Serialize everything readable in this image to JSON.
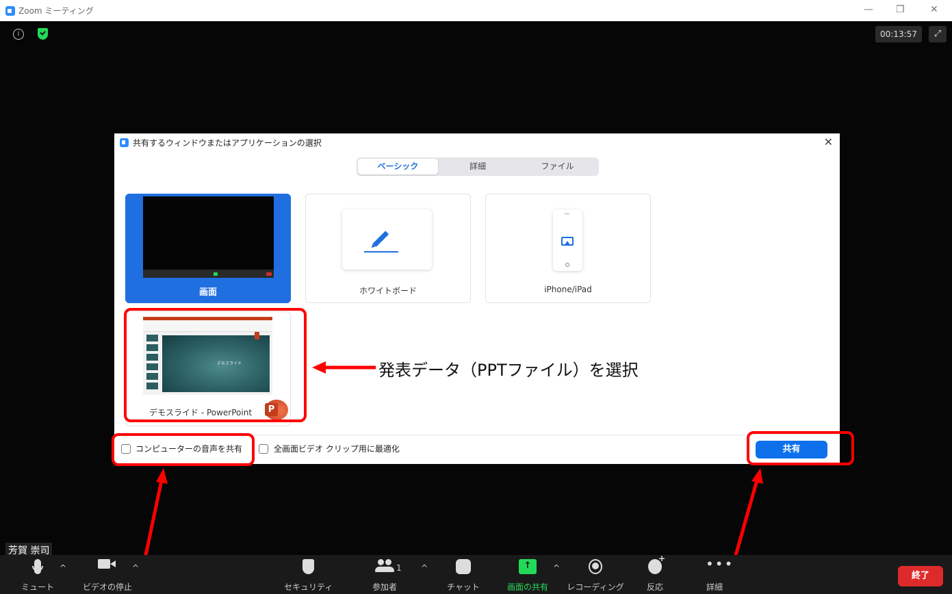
{
  "window": {
    "title": "Zoom ミーティング",
    "minimize": "—",
    "restore": "❐",
    "close": "✕"
  },
  "meeting": {
    "info_icon_glyph": "i",
    "timer": "00:13:57",
    "fullscreen_glyph": "⤢",
    "participant_name": "芳賀 崇司"
  },
  "dialog": {
    "title": "共有するウィンドウまたはアプリケーションの選択",
    "close": "✕",
    "tabs": [
      {
        "label": "ベーシック",
        "active": true
      },
      {
        "label": "詳細",
        "active": false
      },
      {
        "label": "ファイル",
        "active": false
      }
    ],
    "tiles": {
      "screen": "画面",
      "whiteboard": "ホワイトボード",
      "iphone": "iPhone/iPad",
      "ppt": "デモスライド - PowerPoint",
      "ppt_slide_text": "デモスライド",
      "ppt_badge": "P"
    },
    "options": {
      "share_audio": "コンピューターの音声を共有",
      "optimize_video": "全画面ビデオ クリップ用に最適化"
    },
    "share_button": "共有"
  },
  "annotation": {
    "callout": "発表データ（PPTファイル）を選択",
    "color": "#ff0000"
  },
  "toolbar": {
    "mute": "ミュート",
    "stop_video": "ビデオの停止",
    "security": "セキュリティ",
    "participants": "参加者",
    "participant_count": "1",
    "chat": "チャット",
    "share_screen": "画面の共有",
    "recording": "レコーディング",
    "reactions": "反応",
    "more": "詳細",
    "end": "終了",
    "share_glyph": "↑",
    "more_glyph": "•••",
    "caret": "^"
  },
  "colors": {
    "zoom_blue": "#0e71eb",
    "share_green": "#23d959",
    "end_red": "#dd2b2b"
  }
}
